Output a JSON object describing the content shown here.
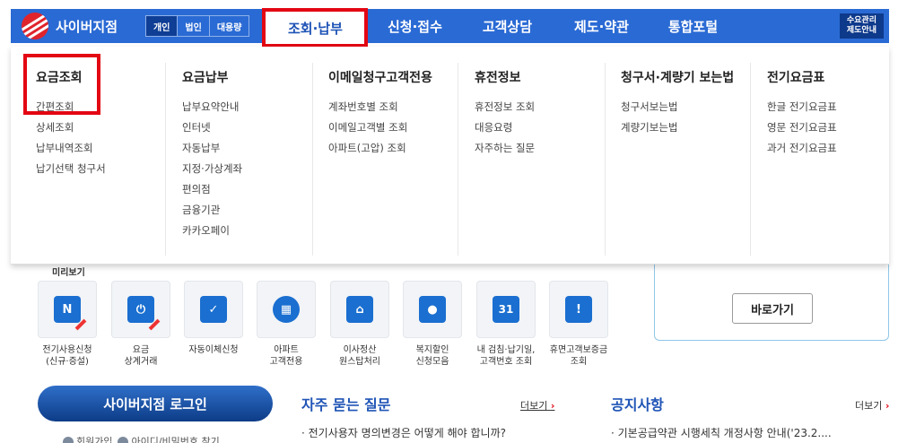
{
  "brand": {
    "name": "사이버지점"
  },
  "user_tabs": [
    "개인",
    "법인",
    "대용량"
  ],
  "main_menu": [
    "조회·납부",
    "신청·접수",
    "고객상담",
    "제도·약관",
    "통합포털"
  ],
  "top_right_button": {
    "line1": "수요관리",
    "line2": "제도안내"
  },
  "mega_menu": [
    {
      "title": "요금조회",
      "items": [
        "간편조회",
        "상세조회",
        "납부내역조회",
        "납기선택 청구서"
      ]
    },
    {
      "title": "요금납부",
      "items": [
        "납부요약안내",
        "인터넷",
        "자동납부",
        "지정·가상계좌",
        "편의점",
        "금융기관",
        "카카오페이"
      ]
    },
    {
      "title": "이메일청구고객전용",
      "items": [
        "계좌번호별 조회",
        "이메일고객별 조회",
        "아파트(고압) 조회"
      ]
    },
    {
      "title": "휴전정보",
      "items": [
        "휴전정보 조회",
        "대응요령",
        "자주하는 질문"
      ]
    },
    {
      "title": "청구서·계량기 보는법",
      "items": [
        "청구서보는법",
        "계량기보는법"
      ]
    },
    {
      "title": "전기요금표",
      "items": [
        "한글 전기요금표",
        "영문 전기요금표",
        "과거 전기요금표"
      ]
    }
  ],
  "right_panel": {
    "button": "바로가기"
  },
  "quick": {
    "title": "미리보기",
    "tiles": [
      {
        "icon": "document-n-icon",
        "glyph": "N",
        "line1": "전기사용신청",
        "line2": "(신규·증설)"
      },
      {
        "icon": "plug-icon",
        "glyph": "⏻",
        "line1": "요금",
        "line2": "상계거래"
      },
      {
        "icon": "checklist-icon",
        "glyph": "✓",
        "line1": "자동이체신청",
        "line2": ""
      },
      {
        "icon": "building-icon",
        "glyph": "▦",
        "line1": "아파트",
        "line2": "고객전용"
      },
      {
        "icon": "house-icon",
        "glyph": "⌂",
        "line1": "이사정산",
        "line2": "원스탑처리"
      },
      {
        "icon": "person-card-icon",
        "glyph": "●",
        "line1": "복지할인",
        "line2": "신청모음"
      },
      {
        "icon": "calendar-icon",
        "glyph": "31",
        "line1": "내 검침·납기일,",
        "line2": "고객번호 조회"
      },
      {
        "icon": "alert-doc-icon",
        "glyph": "!",
        "line1": "휴면고객보증금",
        "line2": "조회"
      }
    ]
  },
  "login": {
    "button": "사이버지점 로그인",
    "signup": "회원가입",
    "find": "아이디/비밀번호 찾기"
  },
  "faq": {
    "title": "자주 묻는 질문",
    "more": "더보기",
    "items": [
      "전기사용자 명의변경은 어떻게 해야 합니까?"
    ]
  },
  "notice": {
    "title": "공지사항",
    "more": "더보기",
    "items": [
      "기본공급약관 시행세칙 개정사항 안내('23.2...."
    ]
  },
  "colors": {
    "primary": "#2a6ad4",
    "highlight": "#e30613",
    "dark": "#0e3a8c"
  }
}
